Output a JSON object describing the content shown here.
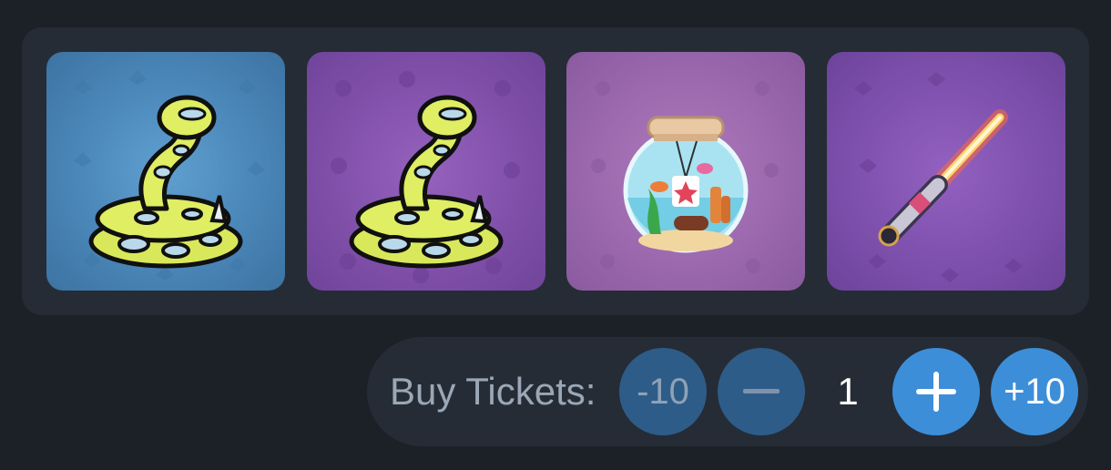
{
  "prizes": [
    {
      "name": "snake",
      "icon": "snake-icon",
      "background": "#4a86b8"
    },
    {
      "name": "snake",
      "icon": "snake-icon",
      "background": "#7f4fa8"
    },
    {
      "name": "fishbowl",
      "icon": "fishbowl-icon",
      "background": "#9a67ad"
    },
    {
      "name": "lightsaber",
      "icon": "lightsaber-icon",
      "background": "#7c4fab"
    }
  ],
  "tickets": {
    "label": "Buy Tickets:",
    "minus_ten_label": "-10",
    "minus_icon": "minus-icon",
    "quantity": "1",
    "plus_icon": "plus-icon",
    "plus_ten_label": "+10"
  },
  "colors": {
    "background": "#1c2127",
    "panel": "#252c35",
    "button_dim": "#2e5c88",
    "button_active": "#3d8ed9"
  }
}
